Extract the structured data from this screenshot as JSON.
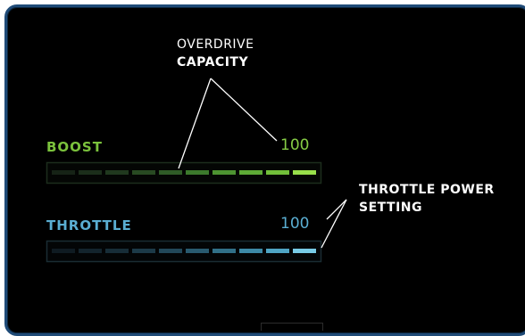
{
  "annotations": {
    "overdrive_line1": "OVERDRIVE",
    "overdrive_line2": "CAPACITY",
    "throttle_line1": "THROTTLE POWER",
    "throttle_line2": "SETTING"
  },
  "boost": {
    "label": "BOOST",
    "value": "100",
    "level": 1.0,
    "segments": 10,
    "colors": [
      "#162316",
      "#1b2e1a",
      "#20391e",
      "#284a22",
      "#2f5c27",
      "#3c7a2c",
      "#4d9431",
      "#5eab36",
      "#72c03a",
      "#98e04a"
    ],
    "color": "#7bc23c"
  },
  "throttle": {
    "label": "THROTTLE",
    "value": "100",
    "level": 1.0,
    "segments": 10,
    "colors": [
      "#0f1b22",
      "#13242d",
      "#172d38",
      "#1c3a48",
      "#224859",
      "#295a6f",
      "#317088",
      "#3d89a6",
      "#4fa5c4",
      "#78cbe6"
    ],
    "color": "#5aaed2"
  }
}
